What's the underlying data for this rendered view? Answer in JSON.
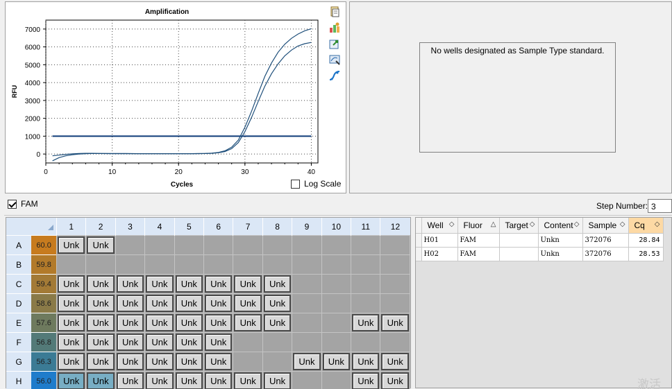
{
  "chart": {
    "title": "Amplification",
    "ylabel": "RFU",
    "xlabel": "Cycles",
    "log_scale_label": "Log Scale",
    "log_scale_checked": false
  },
  "chart_data": {
    "type": "line",
    "title": "Amplification",
    "xlabel": "Cycles",
    "ylabel": "RFU",
    "xlim": [
      0,
      41
    ],
    "ylim": [
      -500,
      7500
    ],
    "x_ticks": [
      "0",
      "10",
      "20",
      "30",
      "40"
    ],
    "y_ticks": [
      "0",
      "1000",
      "2000",
      "3000",
      "4000",
      "5000",
      "6000",
      "7000"
    ],
    "grid": true,
    "threshold": 1000,
    "series": [
      {
        "x": [
          1,
          2,
          3,
          4,
          5,
          6,
          7,
          8,
          10,
          12,
          14,
          16,
          18,
          20,
          22,
          24,
          25,
          26,
          27,
          28,
          29,
          30,
          31,
          32,
          33,
          34,
          35,
          36,
          37,
          38,
          39,
          40
        ],
        "values": [
          -100,
          -60,
          -20,
          10,
          30,
          40,
          40,
          30,
          20,
          20,
          20,
          20,
          20,
          20,
          20,
          30,
          50,
          90,
          180,
          380,
          780,
          1500,
          2400,
          3400,
          4350,
          5100,
          5700,
          6150,
          6480,
          6720,
          6900,
          7020
        ]
      },
      {
        "x": [
          1,
          2,
          3,
          4,
          5,
          6,
          7,
          8,
          10,
          12,
          14,
          16,
          18,
          20,
          22,
          24,
          25,
          26,
          27,
          28,
          29,
          30,
          31,
          32,
          33,
          34,
          35,
          36,
          37,
          38,
          39,
          40
        ],
        "values": [
          -380,
          -200,
          -100,
          -40,
          0,
          20,
          30,
          30,
          30,
          30,
          20,
          20,
          20,
          20,
          20,
          30,
          40,
          70,
          140,
          300,
          640,
          1250,
          2050,
          2950,
          3800,
          4500,
          5050,
          5500,
          5820,
          6050,
          6180,
          6250
        ]
      }
    ]
  },
  "tools": {
    "icons": [
      "copy-icon",
      "chart-settings-icon",
      "export-icon",
      "zoom-icon",
      "curve-icon"
    ]
  },
  "right_panel": {
    "message": "No wells designated as Sample Type standard."
  },
  "fluor": {
    "label": "FAM",
    "checked": true
  },
  "step": {
    "label": "Step Number:",
    "value": "3"
  },
  "plate": {
    "columns": [
      "1",
      "2",
      "3",
      "4",
      "5",
      "6",
      "7",
      "8",
      "9",
      "10",
      "11",
      "12"
    ],
    "rows": [
      {
        "label": "A",
        "temp": "60.0",
        "color": "#c77b1e",
        "wells": [
          "Unk",
          "Unk",
          "",
          "",
          "",
          "",
          "",
          "",
          "",
          "",
          "",
          ""
        ]
      },
      {
        "label": "B",
        "temp": "59.8",
        "color": "#b27a2a",
        "wells": [
          "",
          "",
          "",
          "",
          "",
          "",
          "",
          "",
          "",
          "",
          "",
          ""
        ]
      },
      {
        "label": "C",
        "temp": "59.4",
        "color": "#a37a36",
        "wells": [
          "Unk",
          "Unk",
          "Unk",
          "Unk",
          "Unk",
          "Unk",
          "Unk",
          "Unk",
          "",
          "",
          "",
          ""
        ]
      },
      {
        "label": "D",
        "temp": "58.6",
        "color": "#8a7a48",
        "wells": [
          "Unk",
          "Unk",
          "Unk",
          "Unk",
          "Unk",
          "Unk",
          "Unk",
          "Unk",
          "",
          "",
          "",
          ""
        ]
      },
      {
        "label": "E",
        "temp": "57.6",
        "color": "#6e7a5e",
        "wells": [
          "Unk",
          "Unk",
          "Unk",
          "Unk",
          "Unk",
          "Unk",
          "Unk",
          "Unk",
          "",
          "",
          "Unk",
          "Unk"
        ]
      },
      {
        "label": "F",
        "temp": "56.8",
        "color": "#537a78",
        "wells": [
          "Unk",
          "Unk",
          "Unk",
          "Unk",
          "Unk",
          "Unk",
          "",
          "",
          "",
          "",
          "",
          ""
        ]
      },
      {
        "label": "G",
        "temp": "56.3",
        "color": "#3b7b95",
        "wells": [
          "Unk",
          "Unk",
          "Unk",
          "Unk",
          "Unk",
          "Unk",
          "",
          "",
          "Unk",
          "Unk",
          "Unk",
          "Unk"
        ]
      },
      {
        "label": "H",
        "temp": "56.0",
        "color": "#1f7ccb",
        "wells": [
          "Unk",
          "Unk",
          "Unk",
          "Unk",
          "Unk",
          "Unk",
          "Unk",
          "Unk",
          "",
          "",
          "Unk",
          "Unk"
        ]
      }
    ],
    "selected": [
      "H1",
      "H2"
    ]
  },
  "results": {
    "headers": [
      "Well",
      "Fluor",
      "Target",
      "Content",
      "Sample",
      "Cq"
    ],
    "rows": [
      [
        "H01",
        "FAM",
        "",
        "Unkn",
        "372076",
        "28.84"
      ],
      [
        "H02",
        "FAM",
        "",
        "Unkn",
        "372076",
        "28.53"
      ]
    ]
  },
  "watermark": "激活 W"
}
